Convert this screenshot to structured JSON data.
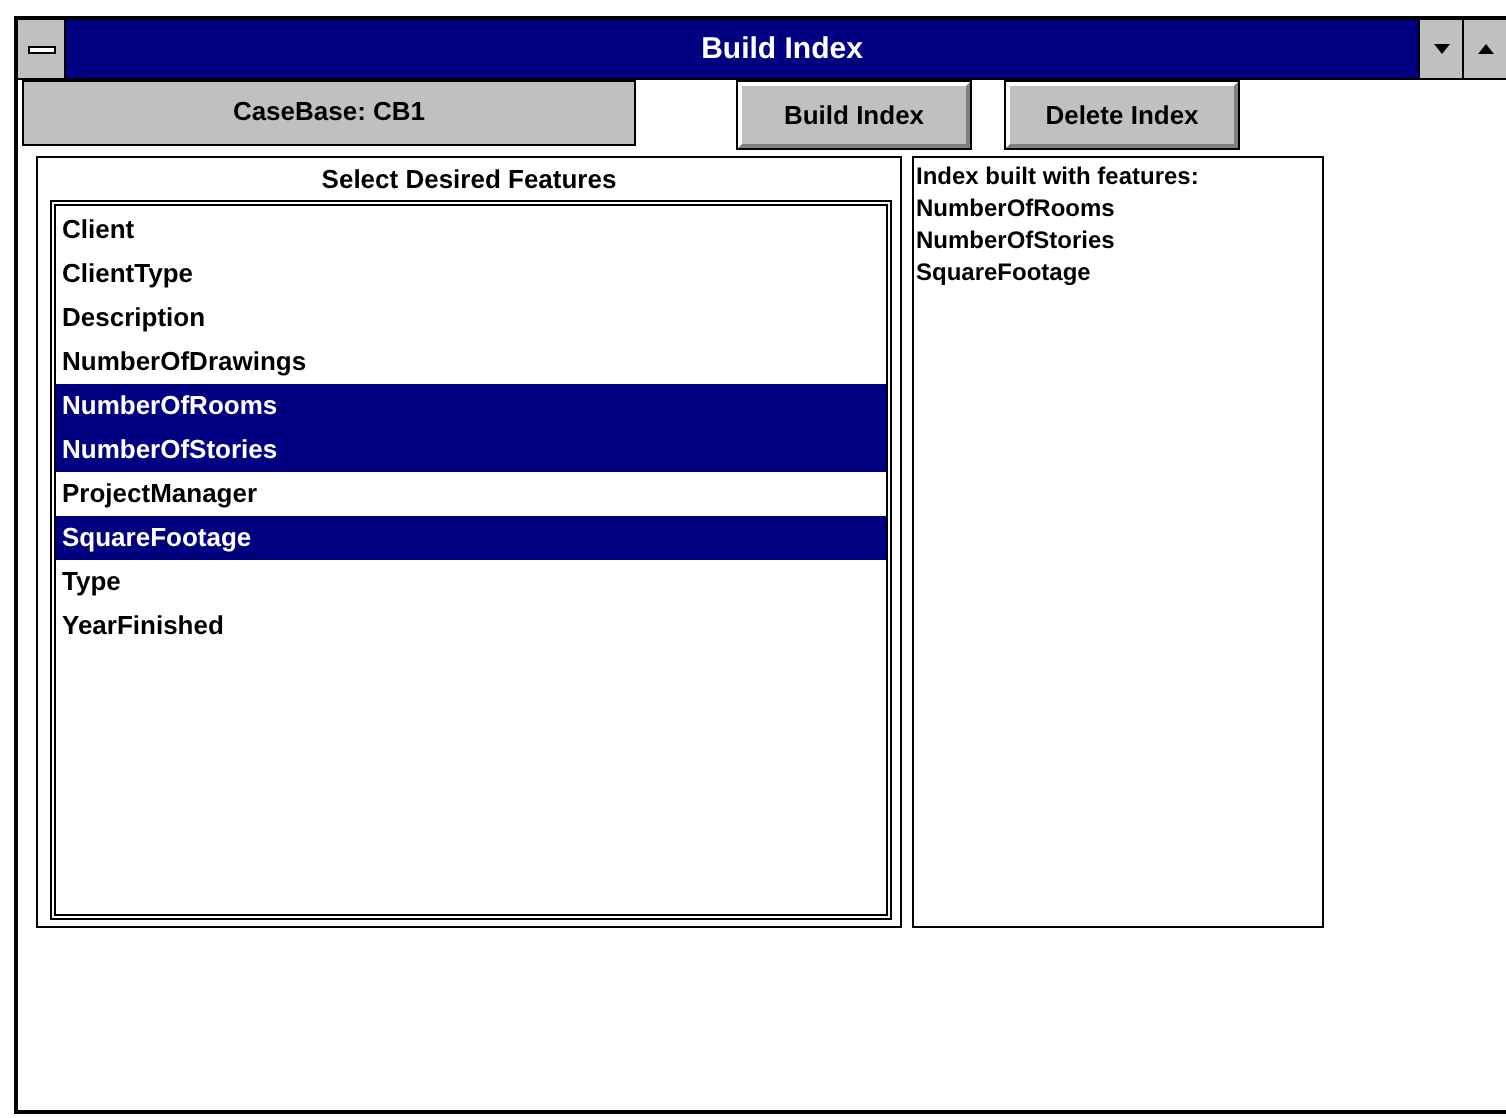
{
  "window": {
    "title": "Build Index"
  },
  "casebase_label": "CaseBase: CB1",
  "buttons": [
    "Build Index",
    "Delete Index"
  ],
  "feature_list": {
    "heading": "Select Desired Features",
    "items": [
      {
        "label": "Client",
        "selected": false
      },
      {
        "label": "ClientType",
        "selected": false
      },
      {
        "label": "Description",
        "selected": false
      },
      {
        "label": "NumberOfDrawings",
        "selected": false
      },
      {
        "label": "NumberOfRooms",
        "selected": true
      },
      {
        "label": "NumberOfStories",
        "selected": true
      },
      {
        "label": "ProjectManager",
        "selected": false
      },
      {
        "label": "SquareFootage",
        "selected": true
      },
      {
        "label": "Type",
        "selected": false
      },
      {
        "label": "YearFinished",
        "selected": false
      }
    ]
  },
  "index_output": {
    "lines": [
      "Index built with features:",
      "NumberOfRooms",
      "NumberOfStories",
      "SquareFootage"
    ]
  }
}
